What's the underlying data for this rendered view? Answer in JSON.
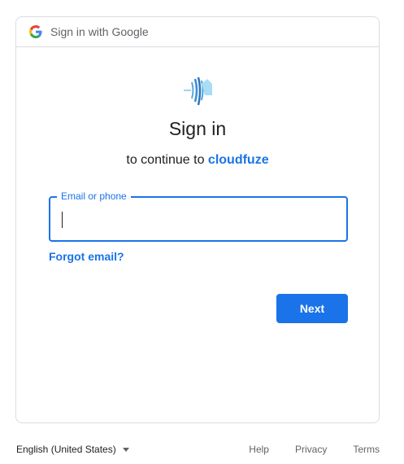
{
  "header": {
    "title": "Sign in with Google",
    "logo_icon": "google-g-icon"
  },
  "app": {
    "logo_icon": "cloudfuze-logo-icon",
    "name": "cloudfuze"
  },
  "main": {
    "title": "Sign in",
    "subtitle_prefix": "to continue to",
    "email_field": {
      "label": "Email or phone",
      "value": ""
    },
    "forgot_email": "Forgot email?",
    "next_button": "Next"
  },
  "footer": {
    "language": "English (United States)",
    "links": [
      "Help",
      "Privacy",
      "Terms"
    ]
  },
  "colors": {
    "accent": "#1a73e8",
    "border": "#dadce0",
    "muted": "#5f6368"
  }
}
